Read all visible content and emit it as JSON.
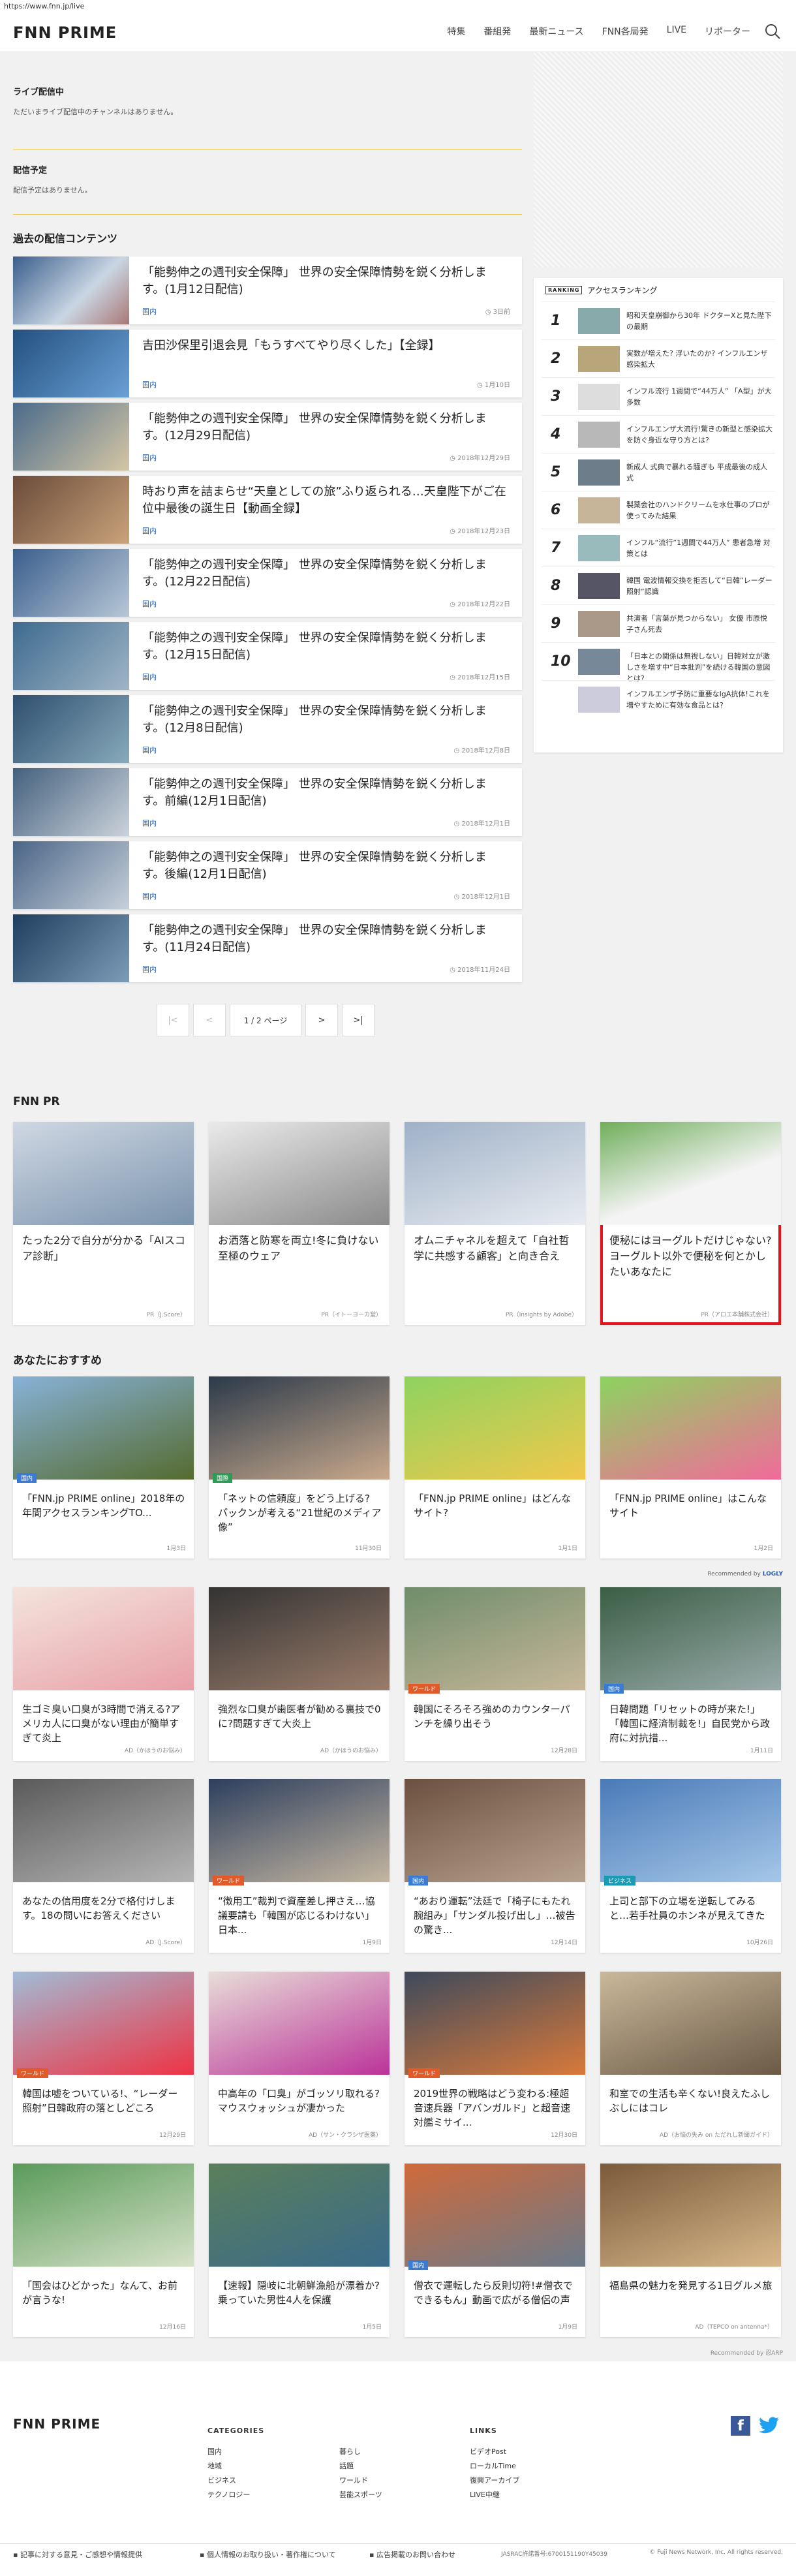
{
  "browser": {
    "url": "https://www.fnn.jp/live"
  },
  "header": {
    "logo": "FNN PRIME",
    "nav": [
      "特集",
      "番組発",
      "最新ニュース",
      "FNN各局発",
      "LIVE",
      "リポーター"
    ]
  },
  "live": {
    "label": "ライブ配信中",
    "message": "ただいまライブ配信中のチャンネルはありません。"
  },
  "schedule": {
    "label": "配信予定",
    "message": "配信予定はありません。"
  },
  "past": {
    "title": "過去の配信コンテンツ",
    "items": [
      {
        "title": "「能勢伸之の週刊安全保障」 世界の安全保障情勢を鋭く分析します。(1月12日配信)",
        "category": "国内",
        "date": "3日前"
      },
      {
        "title": "吉田沙保里引退会見「もうすべてやり尽くした」【全録】",
        "category": "国内",
        "date": "1月10日"
      },
      {
        "title": "「能勢伸之の週刊安全保障」 世界の安全保障情勢を鋭く分析します。(12月29日配信)",
        "category": "国内",
        "date": "2018年12月29日"
      },
      {
        "title": "時おり声を詰まらせ“天皇としての旅”ふり返られる…天皇陛下がご在位中最後の誕生日【動画全録】",
        "category": "国内",
        "date": "2018年12月23日"
      },
      {
        "title": "「能勢伸之の週刊安全保障」 世界の安全保障情勢を鋭く分析します。(12月22日配信)",
        "category": "国内",
        "date": "2018年12月22日"
      },
      {
        "title": "「能勢伸之の週刊安全保障」 世界の安全保障情勢を鋭く分析します。(12月15日配信)",
        "category": "国内",
        "date": "2018年12月15日"
      },
      {
        "title": "「能勢伸之の週刊安全保障」 世界の安全保障情勢を鋭く分析します。(12月8日配信)",
        "category": "国内",
        "date": "2018年12月8日"
      },
      {
        "title": "「能勢伸之の週刊安全保障」 世界の安全保障情勢を鋭く分析します。前編(12月1日配信)",
        "category": "国内",
        "date": "2018年12月1日"
      },
      {
        "title": "「能勢伸之の週刊安全保障」 世界の安全保障情勢を鋭く分析します。後編(12月1日配信)",
        "category": "国内",
        "date": "2018年12月1日"
      },
      {
        "title": "「能勢伸之の週刊安全保障」 世界の安全保障情勢を鋭く分析します。(11月24日配信)",
        "category": "国内",
        "date": "2018年11月24日"
      }
    ]
  },
  "pager": {
    "first": "|<",
    "prev": "<",
    "info": "1 / 2 ページ",
    "next": ">",
    "last": ">|"
  },
  "ranking": {
    "badge": "RANKING",
    "title": "アクセスランキング",
    "items": [
      {
        "n": "1",
        "text": "昭和天皇崩御から30年 ドクターXと見た陛下の最期"
      },
      {
        "n": "2",
        "text": "実数が増えた? 浮いたのか? インフルエンザ感染拡大"
      },
      {
        "n": "3",
        "text": "インフル流行 1週間で“44万人” 「A型」が大多数"
      },
      {
        "n": "4",
        "text": "インフルエンザ大流行!驚きの新型と感染拡大を防ぐ身近な守り方とは?"
      },
      {
        "n": "5",
        "text": "新成人 式典で暴れる騒ぎも 平成最後の成人式"
      },
      {
        "n": "6",
        "text": "製薬会社のハンドクリームを水仕事のプロが使ってみた結果"
      },
      {
        "n": "7",
        "text": "インフル“流行”1週間で44万人” 患者急増 対策とは"
      },
      {
        "n": "8",
        "text": "韓国 電波情報交換を拒否して“日韓”レーダー照射”認識"
      },
      {
        "n": "9",
        "text": "共演者「言葉が見つからない」 女優 市原悦子さん死去"
      },
      {
        "n": "10",
        "text": "「日本との関係は無視しない」日韓対立が激しさを増す中“日本批判”を続ける韓国の意図とは?"
      },
      {
        "n": "",
        "text": "インフルエンザ予防に重要なIgA抗体!これを増やすために有効な食品とは?"
      }
    ]
  },
  "pr": {
    "title": "FNN PR",
    "items": [
      {
        "title": "たった2分で自分が分かる「AIスコア診断」",
        "source": "PR（J.Score）"
      },
      {
        "title": "お洒落と防寒を両立!冬に負けない至極のウェア",
        "source": "PR（イトーヨーカ堂）"
      },
      {
        "title": "オムニチャネルを超えて「自社哲学に共感する顧客」と向き合え",
        "source": "PR（Insights by Adobe）"
      },
      {
        "title": "便秘にはヨーグルトだけじゃない?ヨーグルト以外で便秘を何とかしたいあなたに",
        "source": "PR（アロエ本舗株式会社）"
      }
    ]
  },
  "reco": {
    "title": "あなたにおすすめ",
    "recommended_by": "Recommended by",
    "logly": "LOGLY",
    "rows": [
      [
        {
          "title": "「FNN.jp PRIME online」2018年の年間アクセスランキングTO...",
          "badge": "国内",
          "meta": "1月3日"
        },
        {
          "title": "「ネットの信頼度」をどう上げる? パックンが考える“21世紀のメディア像”",
          "badge": "国際",
          "meta": "11月30日"
        },
        {
          "title": "「FNN.jp PRIME online」はどんなサイト?",
          "badge": "",
          "meta": "1月1日"
        },
        {
          "title": "「FNN.jp PRIME online」はこんなサイト",
          "badge": "",
          "meta": "1月2日"
        }
      ],
      [
        {
          "title": "生ゴミ臭い口臭が3時間で消える?アメリカ人に口臭がない理由が簡単すぎて炎上",
          "badge": "",
          "meta": "AD（かほうのお悩み）"
        },
        {
          "title": "強烈な口臭が歯医者が勧める裏技で0に?問題すぎて大炎上",
          "badge": "",
          "meta": "AD（かほうのお悩み）"
        },
        {
          "title": "韓国にそろそろ強めのカウンターパンチを繰り出そう",
          "badge": "ワールド",
          "meta": "12月28日"
        },
        {
          "title": "日韓問題「リセットの時が来た!」「韓国に経済制裁を!」自民党から政府に対抗措...",
          "badge": "国内",
          "meta": "1月11日"
        }
      ],
      [
        {
          "title": "あなたの信用度を2分で格付けします。18の問いにお答えください",
          "badge": "",
          "meta": "AD（J.Score）"
        },
        {
          "title": "“徴用工”裁判で資産差し押さえ…協議要請も「韓国が応じるわけない」 日本...",
          "badge": "ワールド",
          "meta": "1月9日"
        },
        {
          "title": "“あおり運転”法廷で「椅子にもたれ腕組み」「サンダル投げ出し」…被告の驚き...",
          "badge": "国内",
          "meta": "12月14日"
        },
        {
          "title": "上司と部下の立場を逆転してみると…若手社員のホンネが見えてきた",
          "badge": "ビジネス",
          "meta": "10月26日"
        }
      ],
      [
        {
          "title": "韓国は嘘をついている!、“レーダー照射”日韓政府の落としどころ",
          "badge": "ワールド",
          "meta": "12月29日"
        },
        {
          "title": "中高年の「口臭」がゴッソリ取れる?マウスウォッシュが凄かった",
          "badge": "",
          "meta": "AD（サン・クラシザ医薬）"
        },
        {
          "title": "2019世界の戦略はどう変わる:極超音速兵器「アバンガルド」と超音速対艦ミサイ...",
          "badge": "ワールド",
          "meta": "12月30日"
        },
        {
          "title": "和室での生活も辛くない!良えたふしぶしにはコレ",
          "badge": "",
          "meta": "AD（お悩の失み on ただれし新聞ガイド）"
        }
      ],
      [
        {
          "title": "「国会はひどかった」なんて、お前が言うな!",
          "badge": "",
          "meta": "12月16日"
        },
        {
          "title": "【速報】隠岐に北朝鮮漁船が漂着か?乗っていた男性4人を保護",
          "badge": "",
          "meta": "1月5日"
        },
        {
          "title": "僧衣で運転したら反則切符!#僧衣でできるもん」動画で広がる僧侶の声",
          "badge": "国内",
          "meta": "1月9日"
        },
        {
          "title": "福島県の魅力を発見する1日グルメ旅",
          "badge": "",
          "meta": "AD（TEPCO on antenna*）"
        }
      ]
    ],
    "bottom_note": "Recommended by 忍ARP"
  },
  "footer": {
    "logo": "FNN PRIME",
    "categories_title": "CATEGORIES",
    "categories": [
      "国内",
      "地域",
      "ビジネス",
      "テクノロジー",
      "暮らし",
      "話題",
      "ワールド",
      "芸能スポーツ"
    ],
    "links_title": "LINKS",
    "links": [
      "ビデオPost",
      "ローカルTime",
      "復興アーカイブ",
      "LIVE中継"
    ],
    "bottom_links": [
      "記事に対する意見・ご感想や情報提供",
      "個人情報のお取り扱い・著作権について",
      "広告掲載のお問い合わせ"
    ],
    "jasrac": "JASRAC許諾番号:6700151190Y45039",
    "copyright": "© Fuji News Network, Inc. All rights reserved."
  },
  "colors": {
    "accent": "#2a5db0",
    "highlight": "#e5141b",
    "twitter": "#1da1f2",
    "facebook": "#3b5998"
  }
}
